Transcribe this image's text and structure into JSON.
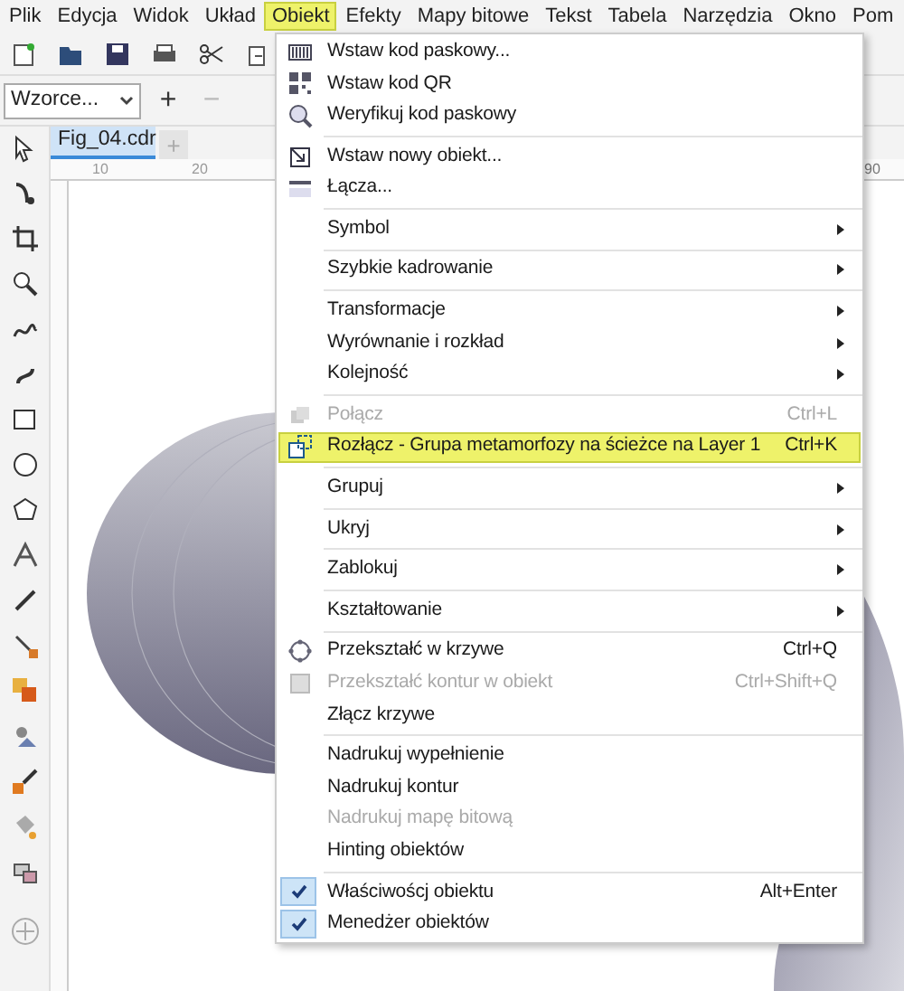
{
  "menu_bar": [
    {
      "label": "Plik",
      "selected": false
    },
    {
      "label": "Edycja",
      "selected": false
    },
    {
      "label": "Widok",
      "selected": false
    },
    {
      "label": "Układ",
      "selected": false
    },
    {
      "label": "Obiekt",
      "selected": true
    },
    {
      "label": "Efekty",
      "selected": false
    },
    {
      "label": "Mapy bitowe",
      "selected": false
    },
    {
      "label": "Tekst",
      "selected": false
    },
    {
      "label": "Tabela",
      "selected": false
    },
    {
      "label": "Narzędzia",
      "selected": false
    },
    {
      "label": "Okno",
      "selected": false
    },
    {
      "label": "Pom",
      "selected": false
    }
  ],
  "property_bar": {
    "preset_dropdown": "Wzorce...",
    "add_button": "+",
    "remove_button": "−"
  },
  "document_tab": {
    "label": "Fig_04.cdr",
    "new_tab": "+"
  },
  "ruler": {
    "labels": [
      "10",
      "20",
      "90"
    ]
  },
  "menu": [
    [
      {
        "label": "Wstaw kod paskowy...",
        "submenu": false,
        "disabled": false,
        "selected": false,
        "checked": false
      },
      {
        "label": "Wstaw kod QR",
        "submenu": false,
        "disabled": false,
        "selected": false,
        "checked": false
      },
      {
        "label": "Weryfikuj kod paskowy",
        "submenu": false,
        "disabled": false,
        "selected": false,
        "checked": false
      }
    ],
    [
      {
        "label": "Wstaw nowy obiekt...",
        "submenu": false,
        "disabled": false,
        "selected": false,
        "checked": false
      },
      {
        "label": "Łącza...",
        "submenu": false,
        "disabled": false,
        "selected": false,
        "checked": false
      }
    ],
    [
      {
        "label": "Symbol",
        "submenu": true,
        "disabled": false,
        "selected": false,
        "checked": false
      }
    ],
    [
      {
        "label": "Szybkie kadrowanie",
        "submenu": true,
        "disabled": false,
        "selected": false,
        "checked": false
      }
    ],
    [
      {
        "label": "Transformacje",
        "submenu": true,
        "disabled": false,
        "selected": false,
        "checked": false
      },
      {
        "label": "Wyrównanie i rozkład",
        "submenu": true,
        "disabled": false,
        "selected": false,
        "checked": false
      },
      {
        "label": "Kolejność",
        "submenu": true,
        "disabled": false,
        "selected": false,
        "checked": false
      }
    ],
    [
      {
        "label": "Połącz",
        "shortcut": "Ctrl+L",
        "submenu": false,
        "disabled": true,
        "selected": false,
        "checked": false
      },
      {
        "label": "Rozłącz - Grupa metamorfozy na ścieżce na Layer 1",
        "shortcut": "Ctrl+K",
        "submenu": false,
        "disabled": false,
        "selected": true,
        "checked": false
      }
    ],
    [
      {
        "label": "Grupuj",
        "submenu": true,
        "disabled": false,
        "selected": false,
        "checked": false
      }
    ],
    [
      {
        "label": "Ukryj",
        "submenu": true,
        "disabled": false,
        "selected": false,
        "checked": false
      }
    ],
    [
      {
        "label": "Zablokuj",
        "submenu": true,
        "disabled": false,
        "selected": false,
        "checked": false
      }
    ],
    [
      {
        "label": "Kształtowanie",
        "submenu": true,
        "disabled": false,
        "selected": false,
        "checked": false
      }
    ],
    [
      {
        "label": "Przekształć w krzywe",
        "shortcut": "Ctrl+Q",
        "submenu": false,
        "disabled": false,
        "selected": false,
        "checked": false
      },
      {
        "label": "Przekształć kontur w obiekt",
        "shortcut": "Ctrl+Shift+Q",
        "submenu": false,
        "disabled": true,
        "selected": false,
        "checked": false
      },
      {
        "label": "Złącz krzywe",
        "submenu": false,
        "disabled": false,
        "selected": false,
        "checked": false
      }
    ],
    [
      {
        "label": "Nadrukuj wypełnienie",
        "submenu": false,
        "disabled": false,
        "selected": false,
        "checked": false
      },
      {
        "label": "Nadrukuj kontur",
        "submenu": false,
        "disabled": false,
        "selected": false,
        "checked": false
      },
      {
        "label": "Nadrukuj mapę bitową",
        "submenu": false,
        "disabled": true,
        "selected": false,
        "checked": false
      },
      {
        "label": "Hinting obiektów",
        "submenu": false,
        "disabled": false,
        "selected": false,
        "checked": false
      }
    ],
    [
      {
        "label": "Właściwoścj obiektu",
        "shortcut": "Alt+Enter",
        "submenu": false,
        "disabled": false,
        "selected": false,
        "checked": true
      },
      {
        "label": "Menedżer obiektów",
        "submenu": false,
        "disabled": false,
        "selected": false,
        "checked": true
      }
    ]
  ]
}
